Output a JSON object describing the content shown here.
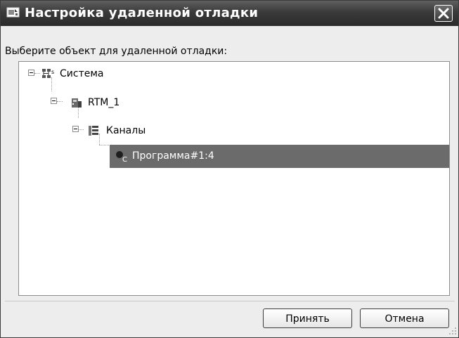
{
  "window": {
    "title": "Настройка удаленной отладки",
    "title_icon": "remote-debug-icon",
    "close_icon": "close-icon"
  },
  "prompt_text": "Выберите объект для удаленной отладки:",
  "tree": {
    "root": {
      "label": "Система",
      "icon": "network-icon",
      "expanded": true
    },
    "device": {
      "label": "RTM_1",
      "icon": "device-icon",
      "expanded": true
    },
    "channels": {
      "label": "Каналы",
      "icon": "channels-icon",
      "expanded": true
    },
    "program": {
      "label": "Программа#1:4",
      "icon": "program-icon",
      "selected": true
    }
  },
  "buttons": {
    "accept": "Принять",
    "cancel": "Отмена"
  },
  "colors": {
    "titlebar": "#3a3a3a",
    "selection": "#6b6b6b",
    "dialog_bg": "#ededed"
  }
}
